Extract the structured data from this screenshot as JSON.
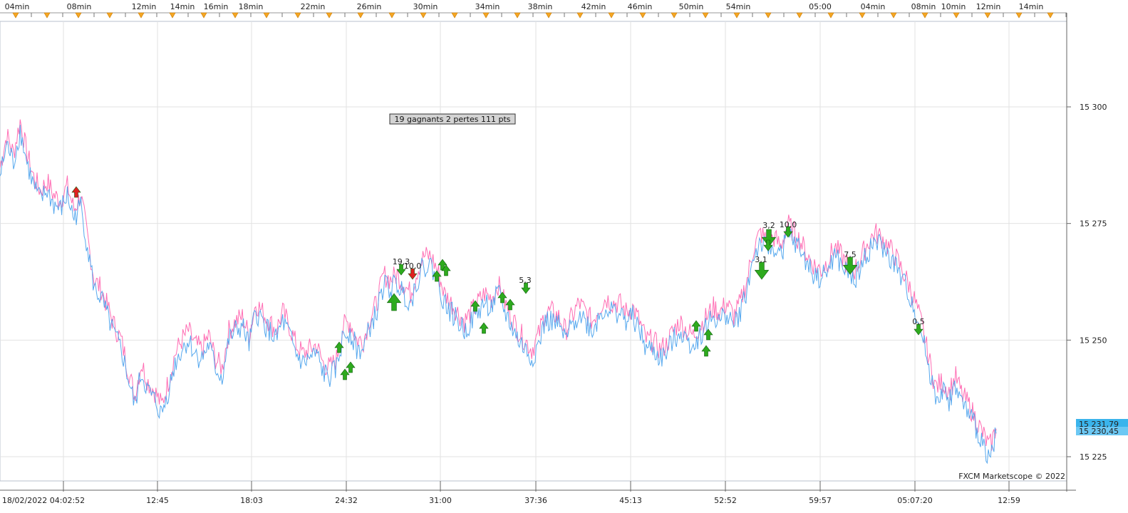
{
  "chart_data": {
    "type": "line",
    "top_ticks": [
      "04min",
      "08min",
      "12min",
      "14min",
      "16min",
      "18min",
      "22min",
      "26min",
      "30min",
      "34min",
      "38min",
      "42min",
      "46min",
      "50min",
      "54min",
      "05:00",
      "04min",
      "08min",
      "10min",
      "12min",
      "14min"
    ],
    "x_labels": [
      "18/02/2022 04:02:52",
      "12:45",
      "18:03",
      "24:32",
      "31:00",
      "37:36",
      "45:13",
      "52:52",
      "59:57",
      "05:07:20",
      "12:59"
    ],
    "y_ticks": [
      15225,
      15250,
      15275,
      15300
    ],
    "y_tick_labels": [
      "15 225",
      "15 250",
      "15 275",
      "15 300"
    ],
    "ylim": [
      15200,
      15325
    ],
    "summary_text": "19 gagnants 2 pertes 111 pts",
    "watermark": "FXCM Marketscope © 2022",
    "price_labels": [
      "15 231,79",
      "15 230,45"
    ],
    "grid": true,
    "series": [
      {
        "color": "#ff6eb4",
        "values": [
          15287,
          15294,
          15290,
          15297,
          15290,
          15285,
          15282,
          15284,
          15281,
          15280,
          15283,
          15278,
          15281,
          15272,
          15263,
          15261,
          15257,
          15253,
          15250,
          15244,
          15238,
          15245,
          15241,
          15239,
          15236,
          15241,
          15247,
          15250,
          15252,
          15249,
          15248,
          15251,
          15246,
          15244,
          15252,
          15254,
          15255,
          15251,
          15258,
          15256,
          15254,
          15252,
          15256,
          15253,
          15249,
          15247,
          15248,
          15249,
          15245,
          15244,
          15246,
          15253,
          15254,
          15250,
          15250,
          15255,
          15258,
          15264,
          15263,
          15264,
          15262,
          15260,
          15265,
          15268,
          15268,
          15265,
          15260,
          15258,
          15256,
          15254,
          15256,
          15258,
          15260,
          15259,
          15262,
          15258,
          15255,
          15252,
          15250,
          15248,
          15251,
          15256,
          15256,
          15255,
          15252,
          15255,
          15258,
          15256,
          15254,
          15257,
          15259,
          15258,
          15258,
          15256,
          15257,
          15254,
          15250,
          15250,
          15248,
          15249,
          15252,
          15254,
          15252,
          15251,
          15253,
          15255,
          15257,
          15256,
          15258,
          15255,
          15258,
          15263,
          15270,
          15273,
          15271,
          15272,
          15270,
          15275,
          15273,
          15271,
          15268,
          15266,
          15265,
          15267,
          15270,
          15268,
          15266,
          15265,
          15268,
          15271,
          15273,
          15272,
          15270,
          15268,
          15265,
          15262,
          15258,
          15253,
          15246,
          15240,
          15241,
          15239,
          15242,
          15238,
          15236,
          15233,
          15230,
          15227,
          15231
        ],
        "label_value": 15231.79
      },
      {
        "color": "#56a8ee",
        "values": [
          15285,
          15292,
          15288,
          15295,
          15288,
          15283,
          15280,
          15282,
          15279,
          15278,
          15281,
          15276,
          15279,
          15270,
          15261,
          15259,
          15255,
          15251,
          15248,
          15242,
          15236,
          15243,
          15239,
          15237,
          15234,
          15239,
          15245,
          15248,
          15250,
          15247,
          15246,
          15249,
          15244,
          15242,
          15250,
          15252,
          15253,
          15249,
          15256,
          15254,
          15252,
          15250,
          15254,
          15251,
          15247,
          15245,
          15246,
          15247,
          15243,
          15242,
          15244,
          15251,
          15252,
          15248,
          15248,
          15253,
          15256,
          15262,
          15261,
          15262,
          15260,
          15258,
          15263,
          15266,
          15266,
          15263,
          15258,
          15256,
          15254,
          15252,
          15254,
          15256,
          15258,
          15257,
          15260,
          15256,
          15253,
          15250,
          15248,
          15246,
          15249,
          15254,
          15254,
          15253,
          15250,
          15253,
          15256,
          15254,
          15252,
          15255,
          15257,
          15256,
          15256,
          15254,
          15255,
          15252,
          15248,
          15248,
          15246,
          15247,
          15250,
          15252,
          15250,
          15249,
          15251,
          15253,
          15255,
          15254,
          15256,
          15253,
          15256,
          15261,
          15268,
          15271,
          15269,
          15270,
          15268,
          15273,
          15271,
          15269,
          15266,
          15264,
          15263,
          15265,
          15268,
          15266,
          15264,
          15263,
          15266,
          15269,
          15271,
          15270,
          15268,
          15266,
          15263,
          15260,
          15256,
          15251,
          15244,
          15238,
          15239,
          15237,
          15240,
          15236,
          15234,
          15231,
          15228,
          15225,
          15230
        ],
        "label_value": 15230.45
      }
    ],
    "annotations": [
      "19,3",
      "10,0",
      "5,3",
      "3,2",
      "10,0",
      "3,1",
      "7,5",
      "0,5"
    ]
  }
}
